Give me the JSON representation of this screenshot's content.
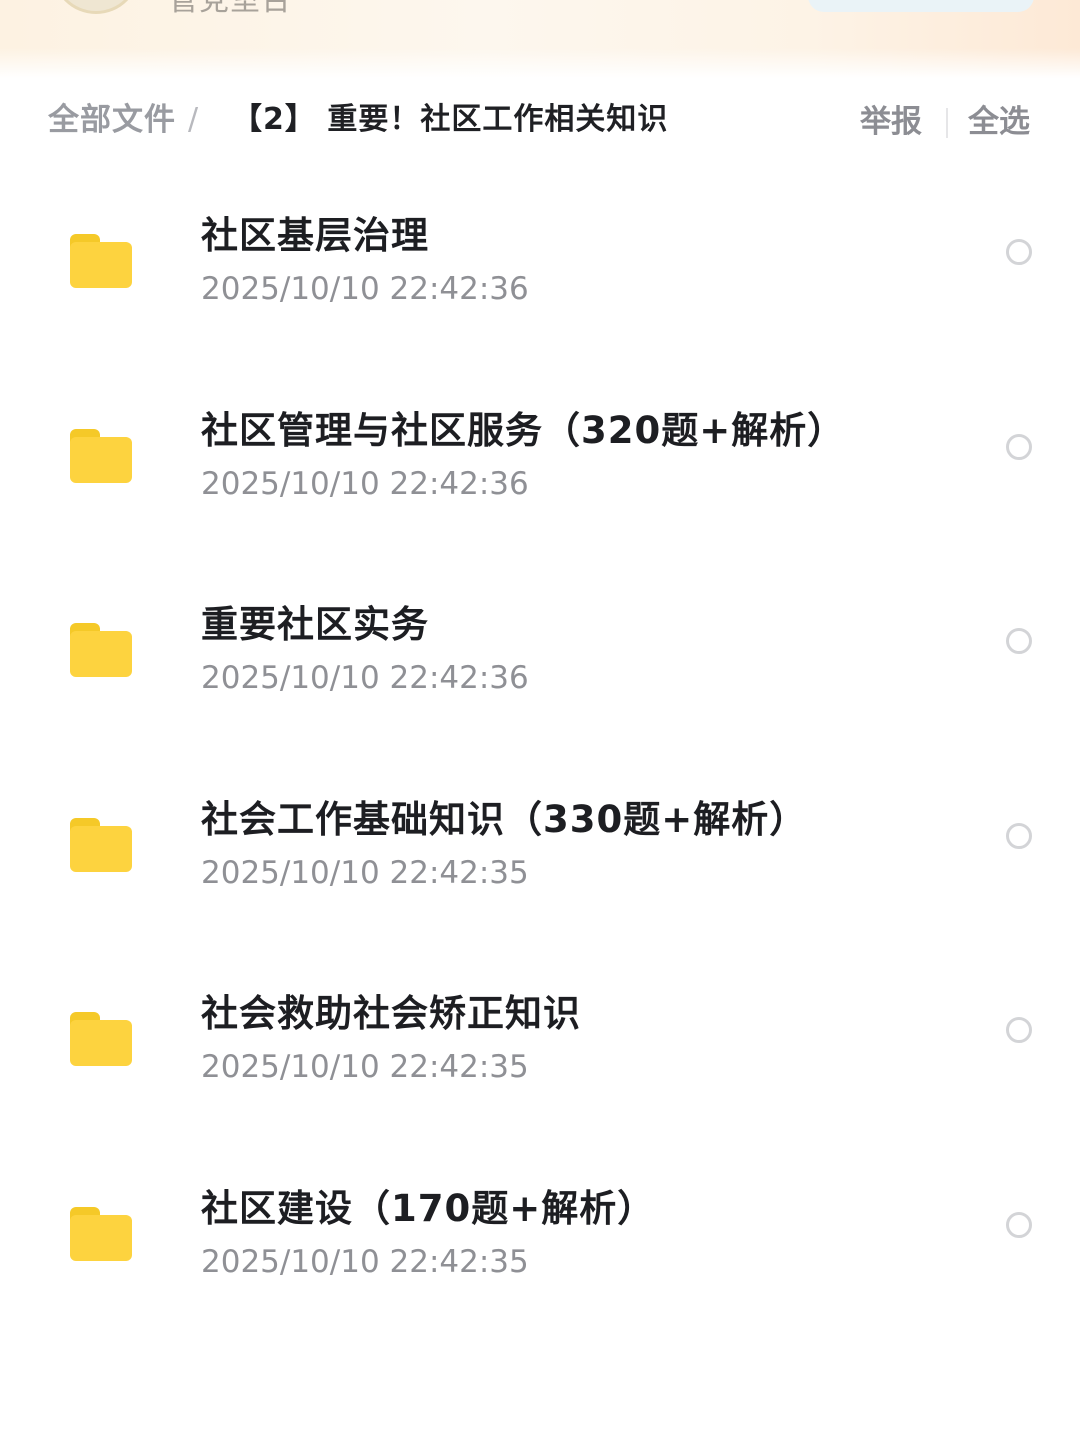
{
  "header": {
    "owner_name": "管党室台"
  },
  "breadcrumb": {
    "root_label": "全部文件",
    "separator": "/",
    "current_label": "【2】 重要！社区工作相关知识"
  },
  "actions": {
    "report_label": "举报",
    "select_all_label": "全选"
  },
  "files": [
    {
      "name": "社区基层治理",
      "time": "2025/10/10 22:42:36",
      "icon": "folder-icon"
    },
    {
      "name": "社区管理与社区服务（320题+解析）",
      "time": "2025/10/10 22:42:36",
      "icon": "folder-icon"
    },
    {
      "name": "重要社区实务",
      "time": "2025/10/10 22:42:36",
      "icon": "folder-icon"
    },
    {
      "name": "社会工作基础知识（330题+解析）",
      "time": "2025/10/10 22:42:35",
      "icon": "folder-icon"
    },
    {
      "name": "社会救助社会矫正知识",
      "time": "2025/10/10 22:42:35",
      "icon": "folder-icon"
    },
    {
      "name": "社区建设（170题+解析）",
      "time": "2025/10/10 22:42:35",
      "icon": "folder-icon"
    }
  ],
  "colors": {
    "folder": "#fdd33f",
    "title_text": "#1d1e22",
    "secondary_text": "#8f9095"
  }
}
